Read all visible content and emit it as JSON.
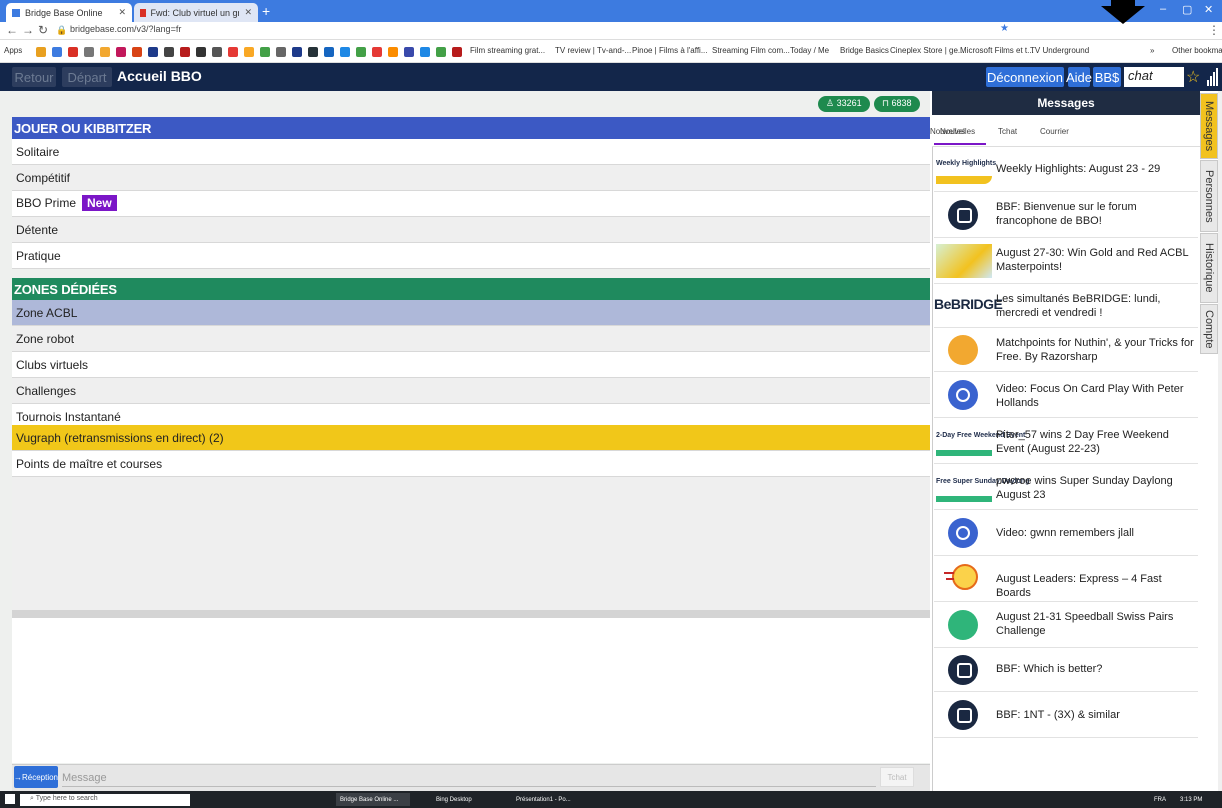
{
  "browser": {
    "tabs": [
      {
        "label": "Bridge Base Online"
      },
      {
        "label": "Fwd: Club virtuel un gros merci :"
      }
    ],
    "new_tab": "+",
    "window_controls": {
      "minimize": "–",
      "maximize": "▢",
      "close": "✕"
    },
    "url": "bridgebase.com/v3/?lang=fr",
    "bookmarks": [
      "Apps",
      "Film streaming grat...",
      "TV review | Tv-and-...",
      "Pinoe | Films à l'affi...",
      "Streaming Film com...",
      "Today / Me",
      "Bridge Basics",
      "Cineplex Store | ge...",
      "Microsoft Films et t...",
      "TV Underground",
      "»",
      "Other bookmarks"
    ]
  },
  "header": {
    "back_label": "Retour",
    "depart_label": "Départ",
    "title": "Accueil BBO",
    "logout_label": "Déconnexion",
    "help_label": "Aide",
    "bbs_label": "BB$",
    "chat_value": "chat"
  },
  "counts": {
    "users": "33261",
    "tables": "6838"
  },
  "play": {
    "heading": "JOUER OU KIBBITZER",
    "items": [
      {
        "label": "Solitaire"
      },
      {
        "label": "Compétitif"
      },
      {
        "label": "BBO Prime",
        "badge": "New"
      },
      {
        "label": "Détente"
      },
      {
        "label": "Pratique"
      }
    ]
  },
  "zones": {
    "heading": "ZONES DÉDIÉES",
    "items": [
      {
        "label": "Zone ACBL"
      },
      {
        "label": "Zone robot"
      },
      {
        "label": "Clubs virtuels"
      },
      {
        "label": "Challenges"
      },
      {
        "label": "Tournois Instantané"
      },
      {
        "label": "Vugraph (retransmissions en direct) (2)"
      },
      {
        "label": "Points de maître et courses"
      }
    ]
  },
  "chatbar": {
    "reception_label": "→Réception",
    "placeholder": "Message",
    "send_label": "Tchat"
  },
  "messages": {
    "title": "Messages",
    "tabs": [
      "Nouvelles",
      "Tchat",
      "Courrier"
    ],
    "news": [
      {
        "thumb": "Weekly Highlights",
        "text": "Weekly Highlights: August 23 - 29"
      },
      {
        "text": "BBF: Bienvenue sur le forum francophone de BBO!"
      },
      {
        "text": "August 27-30: Win Gold and Red ACBL Masterpoints!"
      },
      {
        "thumb": "BeBRIDGE",
        "text": "Les simultanés BeBRIDGE: lundi, mercredi et vendredi !"
      },
      {
        "text": "Matchpoints for Nuthin', & your Tricks for Free. By Razorsharp"
      },
      {
        "text": "Video: Focus On Card Play With Peter Hollands"
      },
      {
        "thumb": "2-Day Free Weekend Event",
        "text": "Piter_57 wins 2 Day Free Weekend Event (August 22-23)"
      },
      {
        "thumb": "Free Super Sunday Daylong",
        "text": "pwcroe wins Super Sunday Daylong August 23"
      },
      {
        "text": "Video: gwnn remembers jlall"
      },
      {
        "text": "August Leaders: Express – 4 Fast Boards"
      },
      {
        "text": "August 21-31 Speedball Swiss Pairs Challenge"
      },
      {
        "text": "BBF: Which is better?"
      },
      {
        "text": "BBF: 1NT - (3X) & similar"
      }
    ]
  },
  "side_tabs": [
    "Messages",
    "Personnes",
    "Historique",
    "Compte"
  ],
  "taskbar": {
    "search_placeholder": "Type here to search",
    "items": [
      "Bridge Base Online ...",
      "Bing Desktop",
      "Présentation1 - Po..."
    ],
    "lang": "FRA",
    "time": "3:13 PM"
  },
  "colors": {
    "play_header": "#3c59c4",
    "zones_header": "#1f8a5e",
    "selected_row": "#aeb8d9",
    "vugraph_row": "#f1c719",
    "header_bg": "#13264a"
  }
}
